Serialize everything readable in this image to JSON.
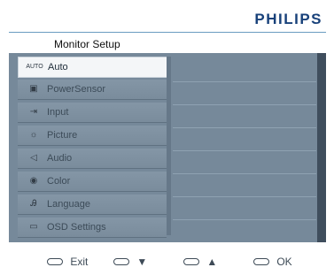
{
  "brand": "PHILIPS",
  "title": "Monitor Setup",
  "menu": {
    "items": [
      {
        "icon": "AUTO",
        "label": "Auto",
        "active": true
      },
      {
        "icon": "▣",
        "label": "PowerSensor",
        "active": false
      },
      {
        "icon": "⇥",
        "label": "Input",
        "active": false
      },
      {
        "icon": "☼",
        "label": "Picture",
        "active": false
      },
      {
        "icon": "◁",
        "label": "Audio",
        "active": false
      },
      {
        "icon": "◉",
        "label": "Color",
        "active": false
      },
      {
        "icon": "Ꭿ",
        "label": "Language",
        "active": false
      },
      {
        "icon": "▭",
        "label": "OSD Settings",
        "active": false
      }
    ]
  },
  "footer": {
    "exit": "Exit",
    "down": "▼",
    "up": "▲",
    "ok": "OK"
  },
  "colors": {
    "brand": "#18417a",
    "panel": "#76899a",
    "active_item": "#f4f6f8"
  }
}
